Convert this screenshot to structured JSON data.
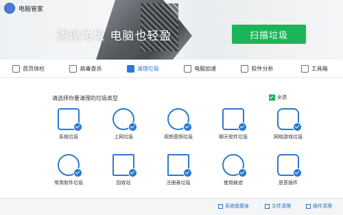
{
  "app": {
    "title": "电脑管家"
  },
  "banner": {
    "slogan": "清理垃圾 电脑也轻盈",
    "scan_button": "扫描垃圾"
  },
  "tabs": [
    {
      "label": "首页体检",
      "icon": "monitor-icon"
    },
    {
      "label": "病毒查杀",
      "icon": "shield-icon"
    },
    {
      "label": "清理垃圾",
      "icon": "broom-icon",
      "active": true
    },
    {
      "label": "电脑加速",
      "icon": "rocket-icon"
    },
    {
      "label": "软件分析",
      "icon": "flower-icon"
    },
    {
      "label": "工具箱",
      "icon": "toolbox-icon"
    }
  ],
  "main": {
    "prompt": "请选择你要清理的垃圾类型",
    "select_all": "全选",
    "items": [
      {
        "label": "系统垃圾",
        "icon": "windows-icon"
      },
      {
        "label": "上网垃圾",
        "icon": "globe-icon"
      },
      {
        "label": "视频音频垃圾",
        "icon": "play-icon"
      },
      {
        "label": "聊天软件垃圾",
        "icon": "chat-icon"
      },
      {
        "label": "网络游戏垃圾",
        "icon": "gamepad-icon"
      },
      {
        "label": "常用软件垃圾",
        "icon": "disc-icon"
      },
      {
        "label": "回收站",
        "icon": "trash-icon"
      },
      {
        "label": "注册表垃圾",
        "icon": "document-icon"
      },
      {
        "label": "使用痕迹",
        "icon": "clock-icon"
      },
      {
        "label": "恶意插件",
        "icon": "puzzle-icon"
      }
    ]
  },
  "footer": {
    "links": [
      {
        "label": "系统盘瘦身",
        "icon": "disk-icon"
      },
      {
        "label": "文件清理",
        "icon": "file-icon"
      },
      {
        "label": "插件清理",
        "icon": "plugin-icon"
      }
    ]
  },
  "colors": {
    "accent": "#2879d0",
    "scan_button": "#1cb45a"
  }
}
